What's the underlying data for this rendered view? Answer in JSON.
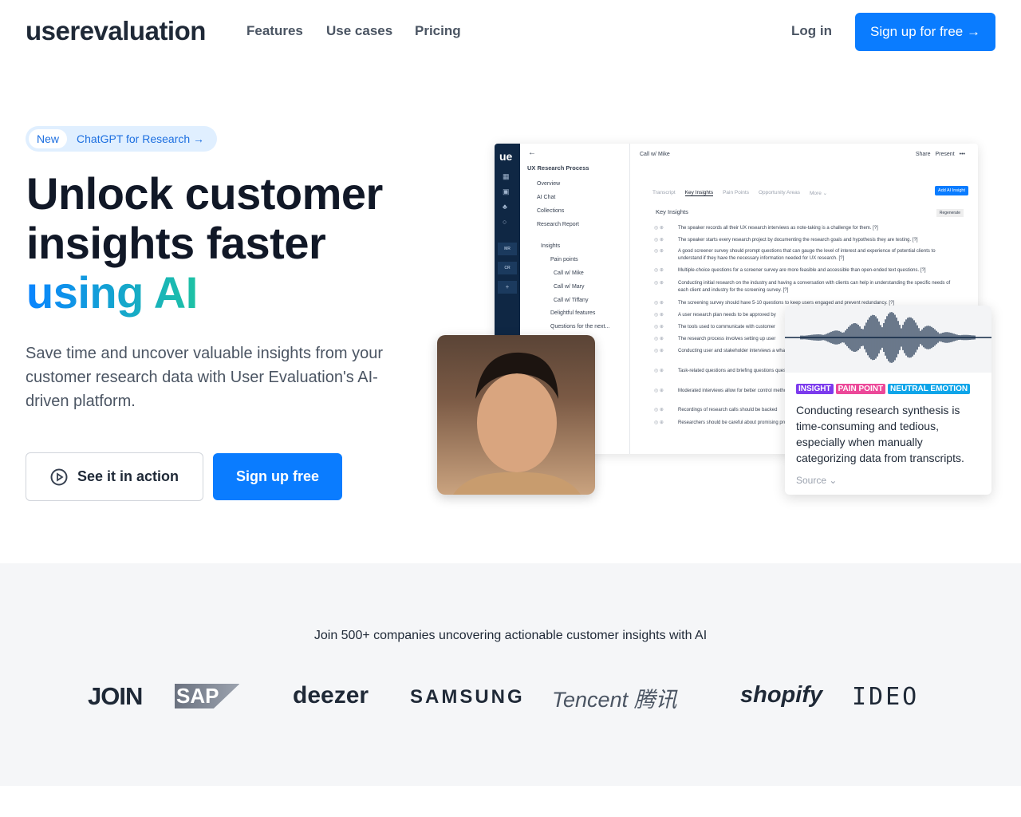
{
  "nav": {
    "logo": "userevaluation",
    "links": [
      "Features",
      "Use cases",
      "Pricing"
    ],
    "login": "Log in",
    "signup": "Sign up for free →"
  },
  "hero": {
    "badge_new": "New",
    "badge_text": "ChatGPT for Research →",
    "title_line1": "Unlock customer",
    "title_line2": "insights faster",
    "title_line3": "using AI",
    "lead": "Save time and uncover valuable insights from your customer research data with User Evaluation's AI-driven platform.",
    "see_action": "See it in action",
    "signup_free": "Sign up free"
  },
  "app": {
    "rail_logo": "ue",
    "rail_badges": [
      "MR",
      "CR",
      "+"
    ],
    "back": "←",
    "project": "UX Research Process",
    "tree": [
      "Overview",
      "AI Chat",
      "Collections",
      "Research Report",
      "Insights",
      "Pain points",
      "Call w/ Mike",
      "Call w/ Mary",
      "Call w/ Tiffany",
      "Delightful features",
      "Questions for the next..."
    ],
    "doc_title": "Call w/ Mike",
    "share": "Share",
    "present": "Present",
    "more_dots": "•••",
    "tabs": [
      "Transcript",
      "Key Insights",
      "Pain Points",
      "Opportunity Areas",
      "More ⌄"
    ],
    "active_tab": "Key Insights",
    "add_ai": "Add AI Insight",
    "section": "Key Insights",
    "regenerate": "Regenerate",
    "insights": [
      "The speaker records all their UX research interviews as note-taking is a challenge for them. [?]",
      "The speaker starts every research project by documenting the research goals and hypothesis they are testing. [?]",
      "A good screener survey should prompt questions that can gauge the level of interest and experience of potential clients to understand if they have the necessary information needed for UX research. [?]",
      "Multiple-choice questions for a screener survey are more feasible and accessible than open-ended text questions. [?]",
      "Conducting initial research on the industry and having a conversation with clients can help in understanding the specific needs of each client and industry for the screening survey. [?]",
      "The screening survey should have 5-10 questions to keep users engaged and prevent redundancy. [?]",
      "A user research plan needs to be approved by",
      "The tools used to communicate with customer",
      "The research process involves setting up user",
      "Conducting user and stakeholder interviews a what is not for a project. [?]",
      "Task-related questions and briefing questions questionnaire. [?]",
      "Moderated interviews allow for better control method. [?]",
      "Recordings of research calls should be backed",
      "Researchers should be careful about promising promised. [?]"
    ]
  },
  "card": {
    "tags": [
      {
        "label": "INSIGHT",
        "color": "#7c3aed"
      },
      {
        "label": "PAIN POINT",
        "color": "#ec4899"
      },
      {
        "label": "NEUTRAL EMOTION",
        "color": "#0ea5e9"
      }
    ],
    "quote": "Conducting research synthesis is time-consuming and tedious, especially when manually categorizing data from transcripts.",
    "source": "Source ⌄"
  },
  "social": {
    "caption": "Join 500+ companies uncovering actionable customer insights with AI",
    "logos": [
      "JOIN",
      "SAP",
      "deezer",
      "SAMSUNG",
      "Tencent 腾讯",
      "shopify",
      "IDEO"
    ]
  }
}
